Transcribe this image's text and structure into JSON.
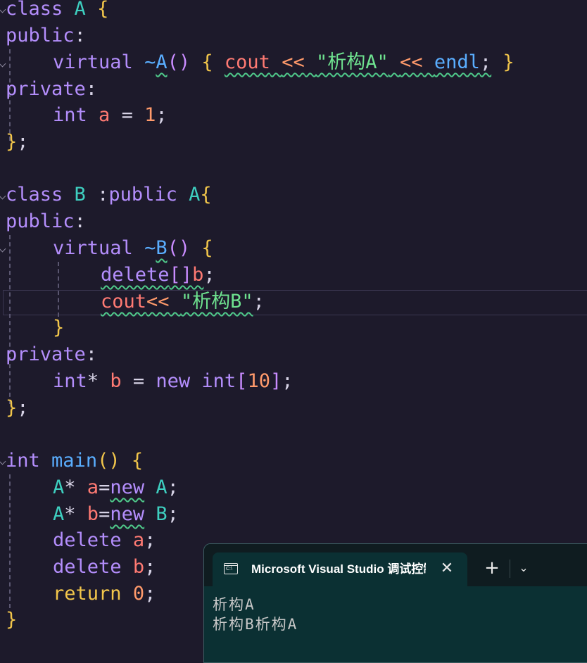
{
  "code": {
    "tokens": {
      "class": "class",
      "public_kw": "public",
      "private_kw": "private",
      "virtual": "virtual",
      "int": "int",
      "new": "new",
      "delete": "delete",
      "return": "return",
      "cout": "cout",
      "endl": "endl",
      "main": "main",
      "A": "A",
      "B": "B",
      "a": "a",
      "b": "b",
      "one": "1",
      "ten": "10",
      "zero": "0",
      "str_a": "\"析构A\"",
      "str_b": "\"析构B\""
    }
  },
  "terminal": {
    "tab_title": "Microsoft Visual Studio 调试控制台",
    "icon_label": "C:\\",
    "close_glyph": "✕",
    "new_tab_glyph": "+",
    "dropdown_glyph": "⌄",
    "output": [
      "析构A",
      "析构B析构A"
    ]
  },
  "colors": {
    "background": "#1d1a2b",
    "keyword": "#b48efc",
    "type": "#3ecfc0",
    "function": "#5aaeff",
    "variable": "#ff7a73",
    "number": "#ff9a6b",
    "string": "#6ee28f",
    "brace": "#f2c64b",
    "terminal_bg": "#0b3033"
  }
}
